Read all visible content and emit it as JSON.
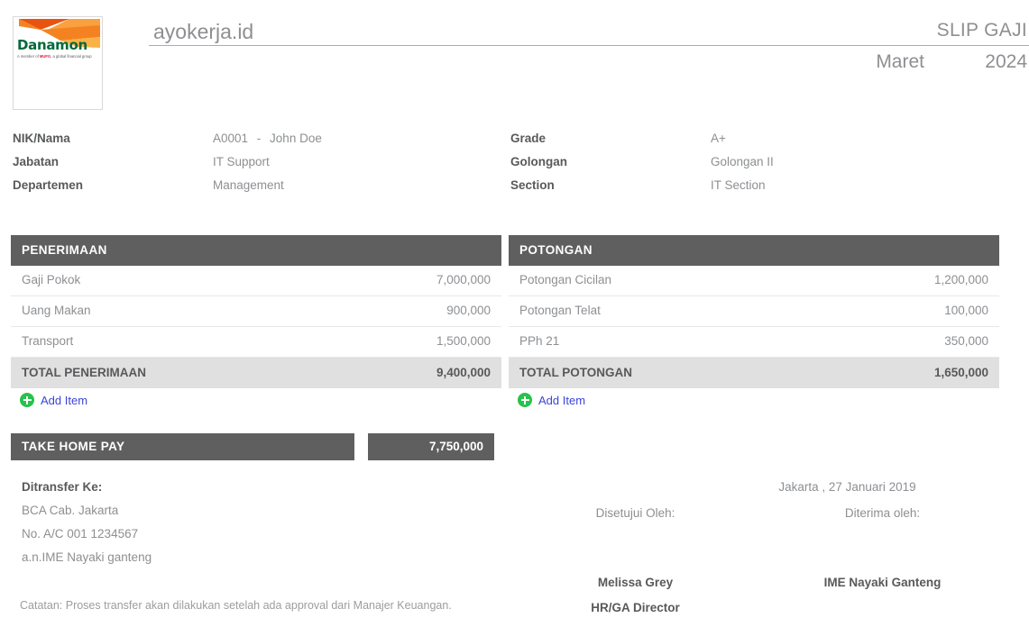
{
  "header": {
    "logo": {
      "brand": "Danamon",
      "tagline_pre": "A member of ",
      "tagline_brand": "MUFG",
      "tagline_post": ", a global financial group"
    },
    "site_title": "ayokerja.id",
    "document_title": "SLIP GAJI",
    "period_month": "Maret",
    "period_year": "2024"
  },
  "employee": {
    "left": [
      {
        "label": "NIK/Nama",
        "value": "A0001",
        "separator": "-",
        "value2": "John Doe"
      },
      {
        "label": "Jabatan",
        "value": "IT Support",
        "separator": "",
        "value2": ""
      },
      {
        "label": "Departemen",
        "value": "Management",
        "separator": "",
        "value2": ""
      }
    ],
    "right": [
      {
        "label": "Grade",
        "value": "A+"
      },
      {
        "label": "Golongan",
        "value": "Golongan II"
      },
      {
        "label": "Section",
        "value": "IT Section"
      }
    ]
  },
  "earnings": {
    "header": "PENERIMAAN",
    "rows": [
      {
        "label": "Gaji Pokok",
        "amount": "7,000,000"
      },
      {
        "label": "Uang Makan",
        "amount": "900,000"
      },
      {
        "label": "Transport",
        "amount": "1,500,000"
      }
    ],
    "total_label": "TOTAL PENERIMAAN",
    "total_amount": "9,400,000",
    "add_item_label": "Add Item"
  },
  "deductions": {
    "header": "POTONGAN",
    "rows": [
      {
        "label": "Potongan Cicilan",
        "amount": "1,200,000"
      },
      {
        "label": "Potongan Telat",
        "amount": "100,000"
      },
      {
        "label": "PPh 21",
        "amount": "350,000"
      }
    ],
    "total_label": "TOTAL POTONGAN",
    "total_amount": "1,650,000",
    "add_item_label": "Add Item"
  },
  "take_home_pay": {
    "label": "TAKE HOME PAY",
    "amount": "7,750,000"
  },
  "transfer": {
    "title": "Ditransfer Ke:",
    "bank": "BCA Cab. Jakarta",
    "account": "No. A/C 001 1234567",
    "holder": "a.n.IME Nayaki ganteng"
  },
  "note": "Catatan: Proses transfer akan dilakukan setelah ada approval dari Manajer Keuangan.",
  "signatures": {
    "place_date": "Jakarta ,  27 Januari 2019",
    "approver": {
      "caption": "Disetujui Oleh:",
      "name": "Melissa Grey",
      "role": "HR/GA Director"
    },
    "receiver": {
      "caption": "Diterima oleh:",
      "name": "IME Nayaki Ganteng",
      "role": ""
    }
  },
  "colors": {
    "header_bar": "#605f5f",
    "total_row": "#e0e0e0",
    "link": "#3b44d6",
    "add_icon": "#27c24c",
    "brand_green": "#00693c",
    "brand_orange": "#f58220",
    "brand_red": "#e31837"
  }
}
